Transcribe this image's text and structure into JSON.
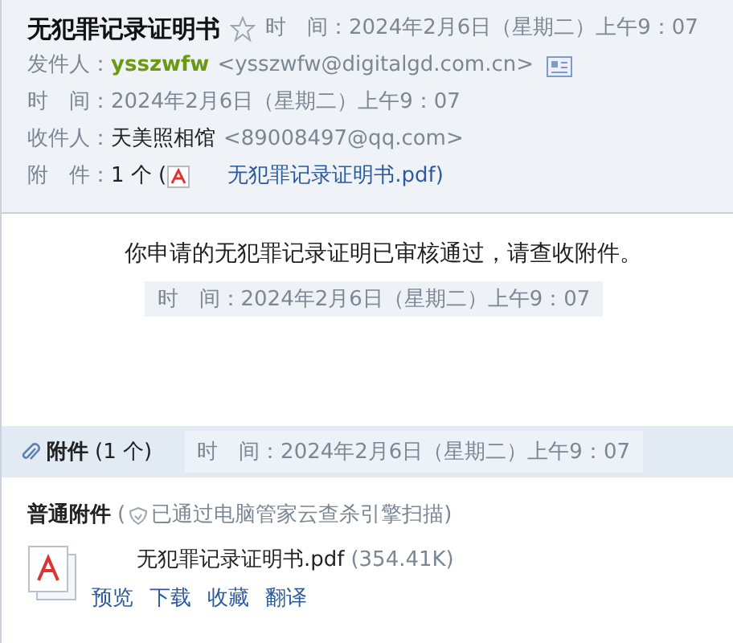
{
  "header": {
    "subject": "无犯罪记录证明书",
    "starred": false,
    "subject_time": "时　间：2024年2月6日（星期二）上午9：07",
    "sender_label": "发件人：",
    "sender_name": "ysszwfw",
    "sender_address": "<ysszwfw@digitalgd.com.cn>",
    "time_label": "时　间：",
    "time_value": "2024年2月6日（星期二）上午9：07",
    "recipient_label": "收件人：",
    "recipient_name": "天美照相馆",
    "recipient_address": "<89008497@qq.com>",
    "attachment_label": "附　件：",
    "attachment_count": "1 个 (",
    "attachment_file": "无犯罪记录证明书.pdf)"
  },
  "body": {
    "message": "你申请的无犯罪记录证明已审核通过，请查收附件。",
    "time": "时　间：2024年2月6日（星期二）上午9：07"
  },
  "attachments": {
    "title": "附件",
    "count": "(1 个)",
    "time": "时　间：2024年2月6日（星期二）上午9：07",
    "section_label": "普通附件",
    "scan_note": "已通过电脑管家云查杀引擎扫描)",
    "scan_open": "(",
    "files": [
      {
        "name": "无犯罪记录证明书.pdf",
        "size": "(354.41K)",
        "actions": [
          "预览",
          "下载",
          "收藏",
          "翻译"
        ]
      }
    ]
  }
}
